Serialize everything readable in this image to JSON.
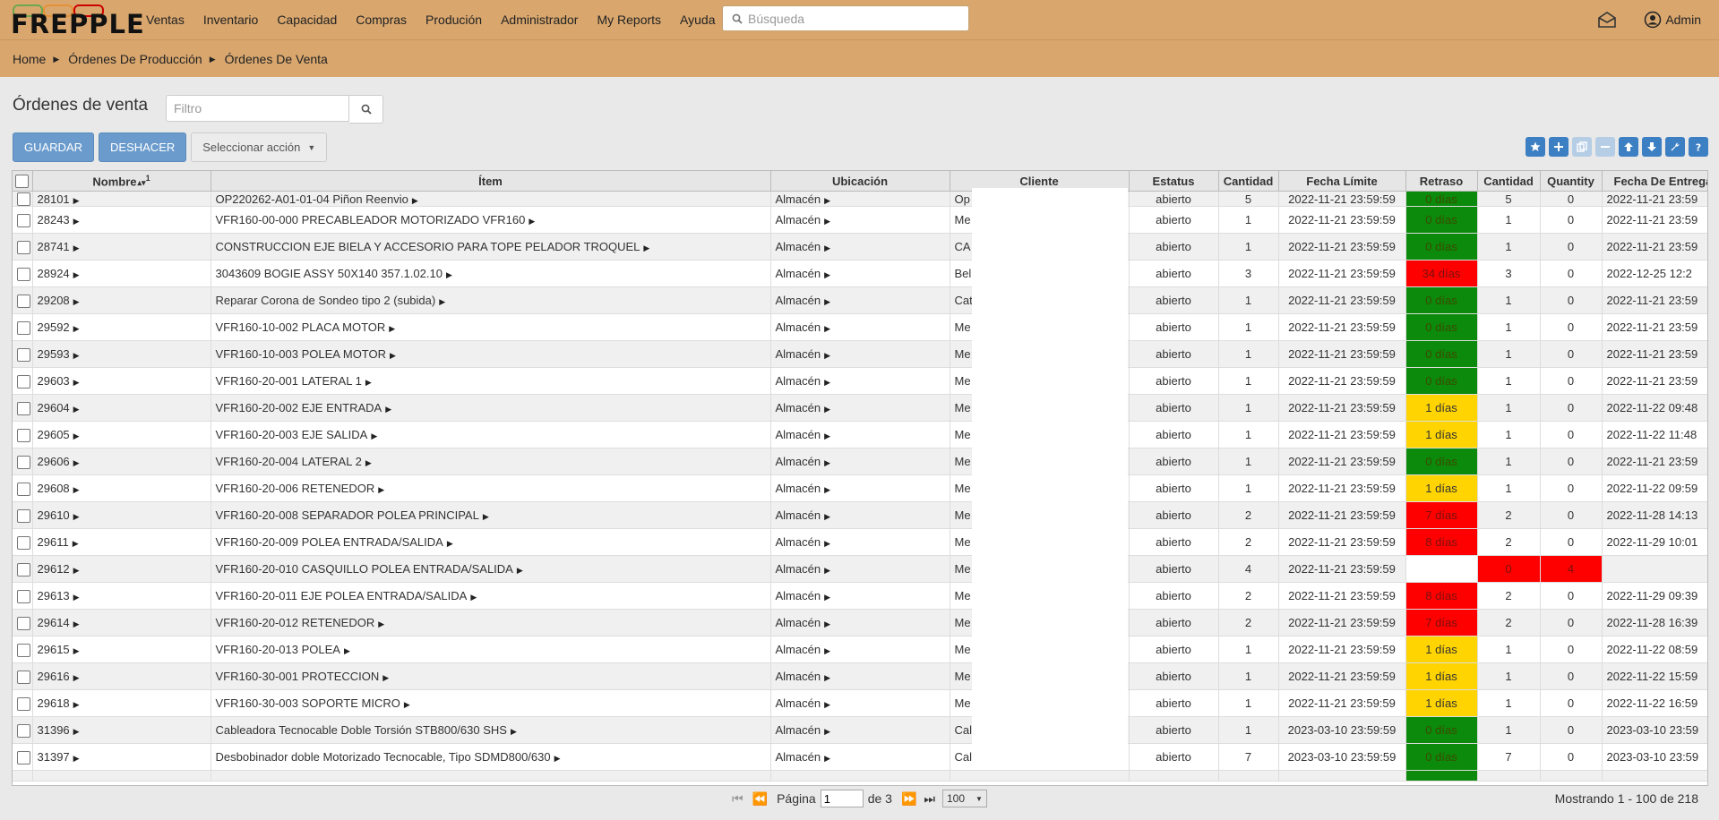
{
  "brand": {
    "name": "FREPPLE",
    "ring_colors": [
      "#6aa84f",
      "#e69138",
      "#cc0000"
    ]
  },
  "nav": {
    "items": [
      "Ventas",
      "Inventario",
      "Capacidad",
      "Compras",
      "Produción",
      "Administrador",
      "My Reports",
      "Ayuda"
    ]
  },
  "search": {
    "placeholder": "Búsqueda"
  },
  "user": {
    "name": "Admin"
  },
  "breadcrumb": [
    "Home",
    "Órdenes De Producción",
    "Órdenes De Venta"
  ],
  "page": {
    "title": "Órdenes de venta",
    "filter_placeholder": "Filtro"
  },
  "actions": {
    "save": "GUARDAR",
    "undo": "DESHACER",
    "select_action": "Seleccionar acción"
  },
  "toolbar_icons": [
    "star-icon",
    "plus-icon",
    "copy-icon",
    "minus-icon",
    "arrow-up-icon",
    "arrow-down-icon",
    "wrench-icon",
    "help-icon"
  ],
  "columns": [
    "Nombre",
    "Ítem",
    "Ubicación",
    "Cliente",
    "Estatus",
    "Cantidad",
    "Fecha Límite",
    "Retraso",
    "Cantidad",
    "Quantity",
    "Fecha De Entrega"
  ],
  "sort_indicator": "1",
  "rows": [
    {
      "name": "28101",
      "item": "OP220262-A01-01-04 Piñon Reenvio",
      "location": "Almacén",
      "customer": "Op",
      "status": "abierto",
      "qty": "5",
      "due": "2022-11-21 23:59:59",
      "delay": "0 días",
      "delay_color": "green",
      "qty2": "5",
      "quantity": "0",
      "delivery": "2022-11-21 23:59"
    },
    {
      "name": "28243",
      "item": "VFR160-00-000 PRECABLEADOR MOTORIZADO VFR160",
      "location": "Almacén",
      "customer": "Me",
      "status": "abierto",
      "qty": "1",
      "due": "2022-11-21 23:59:59",
      "delay": "0 días",
      "delay_color": "green",
      "qty2": "1",
      "quantity": "0",
      "delivery": "2022-11-21 23:59"
    },
    {
      "name": "28741",
      "item": "CONSTRUCCION EJE BIELA Y ACCESORIO PARA TOPE PELADOR TROQUEL",
      "location": "Almacén",
      "customer": "CA",
      "status": "abierto",
      "qty": "1",
      "due": "2022-11-21 23:59:59",
      "delay": "0 días",
      "delay_color": "green",
      "qty2": "1",
      "quantity": "0",
      "delivery": "2022-11-21 23:59"
    },
    {
      "name": "28924",
      "item": "3043609 BOGIE ASSY 50X140 357.1.02.10",
      "location": "Almacén",
      "customer": "Bel",
      "status": "abierto",
      "qty": "3",
      "due": "2022-11-21 23:59:59",
      "delay": "34 días",
      "delay_color": "red",
      "qty2": "3",
      "quantity": "0",
      "delivery": "2022-12-25 12:2"
    },
    {
      "name": "29208",
      "item": "Reparar Corona de Sondeo tipo 2 (subida)",
      "location": "Almacén",
      "customer": "Cat",
      "status": "abierto",
      "qty": "1",
      "due": "2022-11-21 23:59:59",
      "delay": "0 días",
      "delay_color": "green",
      "qty2": "1",
      "quantity": "0",
      "delivery": "2022-11-21 23:59"
    },
    {
      "name": "29592",
      "item": "VFR160-10-002 PLACA MOTOR",
      "location": "Almacén",
      "customer": "Me",
      "status": "abierto",
      "qty": "1",
      "due": "2022-11-21 23:59:59",
      "delay": "0 días",
      "delay_color": "green",
      "qty2": "1",
      "quantity": "0",
      "delivery": "2022-11-21 23:59"
    },
    {
      "name": "29593",
      "item": "VFR160-10-003 POLEA MOTOR",
      "location": "Almacén",
      "customer": "Me",
      "status": "abierto",
      "qty": "1",
      "due": "2022-11-21 23:59:59",
      "delay": "0 días",
      "delay_color": "green",
      "qty2": "1",
      "quantity": "0",
      "delivery": "2022-11-21 23:59"
    },
    {
      "name": "29603",
      "item": "VFR160-20-001 LATERAL 1",
      "location": "Almacén",
      "customer": "Me",
      "status": "abierto",
      "qty": "1",
      "due": "2022-11-21 23:59:59",
      "delay": "0 días",
      "delay_color": "green",
      "qty2": "1",
      "quantity": "0",
      "delivery": "2022-11-21 23:59"
    },
    {
      "name": "29604",
      "item": "VFR160-20-002 EJE ENTRADA",
      "location": "Almacén",
      "customer": "Me",
      "status": "abierto",
      "qty": "1",
      "due": "2022-11-21 23:59:59",
      "delay": "1 días",
      "delay_color": "yellow",
      "qty2": "1",
      "quantity": "0",
      "delivery": "2022-11-22 09:48"
    },
    {
      "name": "29605",
      "item": "VFR160-20-003 EJE SALIDA",
      "location": "Almacén",
      "customer": "Me",
      "status": "abierto",
      "qty": "1",
      "due": "2022-11-21 23:59:59",
      "delay": "1 días",
      "delay_color": "yellow",
      "qty2": "1",
      "quantity": "0",
      "delivery": "2022-11-22 11:48"
    },
    {
      "name": "29606",
      "item": "VFR160-20-004 LATERAL 2",
      "location": "Almacén",
      "customer": "Me",
      "status": "abierto",
      "qty": "1",
      "due": "2022-11-21 23:59:59",
      "delay": "0 días",
      "delay_color": "green",
      "qty2": "1",
      "quantity": "0",
      "delivery": "2022-11-21 23:59"
    },
    {
      "name": "29608",
      "item": "VFR160-20-006 RETENEDOR",
      "location": "Almacén",
      "customer": "Me",
      "status": "abierto",
      "qty": "1",
      "due": "2022-11-21 23:59:59",
      "delay": "1 días",
      "delay_color": "yellow",
      "qty2": "1",
      "quantity": "0",
      "delivery": "2022-11-22 09:59"
    },
    {
      "name": "29610",
      "item": "VFR160-20-008 SEPARADOR POLEA PRINCIPAL",
      "location": "Almacén",
      "customer": "Me",
      "status": "abierto",
      "qty": "2",
      "due": "2022-11-21 23:59:59",
      "delay": "7 días",
      "delay_color": "red",
      "qty2": "2",
      "quantity": "0",
      "delivery": "2022-11-28 14:13"
    },
    {
      "name": "29611",
      "item": "VFR160-20-009 POLEA ENTRADA/SALIDA",
      "location": "Almacén",
      "customer": "Me",
      "status": "abierto",
      "qty": "2",
      "due": "2022-11-21 23:59:59",
      "delay": "8 días",
      "delay_color": "red",
      "qty2": "2",
      "quantity": "0",
      "delivery": "2022-11-29 10:01"
    },
    {
      "name": "29612",
      "item": "VFR160-20-010 CASQUILLO POLEA ENTRADA/SALIDA",
      "location": "Almacén",
      "customer": "Me",
      "status": "abierto",
      "qty": "4",
      "due": "2022-11-21 23:59:59",
      "delay": "",
      "delay_color": "blank",
      "qty2": "0",
      "quantity": "4",
      "delivery": "",
      "qty2_color": "red",
      "quantity_color": "red"
    },
    {
      "name": "29613",
      "item": "VFR160-20-011 EJE POLEA ENTRADA/SALIDA",
      "location": "Almacén",
      "customer": "Me",
      "status": "abierto",
      "qty": "2",
      "due": "2022-11-21 23:59:59",
      "delay": "8 días",
      "delay_color": "red",
      "qty2": "2",
      "quantity": "0",
      "delivery": "2022-11-29 09:39"
    },
    {
      "name": "29614",
      "item": "VFR160-20-012 RETENEDOR",
      "location": "Almacén",
      "customer": "Me",
      "status": "abierto",
      "qty": "2",
      "due": "2022-11-21 23:59:59",
      "delay": "7 días",
      "delay_color": "red",
      "qty2": "2",
      "quantity": "0",
      "delivery": "2022-11-28 16:39"
    },
    {
      "name": "29615",
      "item": "VFR160-20-013 POLEA",
      "location": "Almacén",
      "customer": "Me",
      "status": "abierto",
      "qty": "1",
      "due": "2022-11-21 23:59:59",
      "delay": "1 días",
      "delay_color": "yellow",
      "qty2": "1",
      "quantity": "0",
      "delivery": "2022-11-22 08:59"
    },
    {
      "name": "29616",
      "item": "VFR160-30-001 PROTECCION",
      "location": "Almacén",
      "customer": "Me",
      "status": "abierto",
      "qty": "1",
      "due": "2022-11-21 23:59:59",
      "delay": "1 días",
      "delay_color": "yellow",
      "qty2": "1",
      "quantity": "0",
      "delivery": "2022-11-22 15:59"
    },
    {
      "name": "29618",
      "item": "VFR160-30-003 SOPORTE MICRO",
      "location": "Almacén",
      "customer": "Me",
      "status": "abierto",
      "qty": "1",
      "due": "2022-11-21 23:59:59",
      "delay": "1 días",
      "delay_color": "yellow",
      "qty2": "1",
      "quantity": "0",
      "delivery": "2022-11-22 16:59"
    },
    {
      "name": "31396",
      "item": "Cableadora Tecnocable Doble Torsión STB800/630 SHS",
      "location": "Almacén",
      "customer": "Cal",
      "status": "abierto",
      "qty": "1",
      "due": "2023-03-10 23:59:59",
      "delay": "0 días",
      "delay_color": "green",
      "qty2": "1",
      "quantity": "0",
      "delivery": "2023-03-10 23:59"
    },
    {
      "name": "31397",
      "item": "Desbobinador doble Motorizado Tecnocable, Tipo SDMD800/630",
      "location": "Almacén",
      "customer": "Cal",
      "status": "abierto",
      "qty": "7",
      "due": "2023-03-10 23:59:59",
      "delay": "0 días",
      "delay_color": "green",
      "qty2": "7",
      "quantity": "0",
      "delivery": "2023-03-10 23:59"
    }
  ],
  "pager": {
    "page_label": "Página",
    "page": "1",
    "of_label": "de 3",
    "page_size": "100",
    "showing": "Mostrando 1 - 100 de 218"
  }
}
